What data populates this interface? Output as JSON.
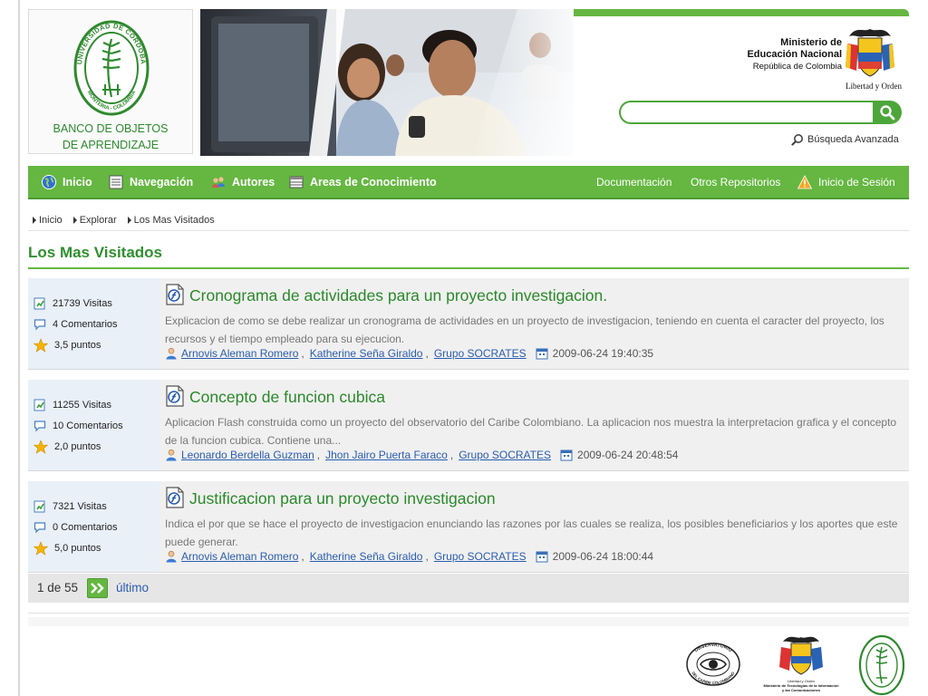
{
  "header": {
    "site_name_line1": "BANCO DE OBJETOS",
    "site_name_line2": "DE APRENDIZAJE",
    "seal_top_text": "UNIVERSIDAD DE CORDOBA",
    "seal_bottom_text": "MONTERIA - COLOMBIA",
    "ministry_line1": "Ministerio de",
    "ministry_line2": "Educación Nacional",
    "ministry_line3": "República de Colombia",
    "motto": "Libertad y Orden",
    "search_placeholder": "",
    "advanced_search": "Búsqueda Avanzada"
  },
  "nav": {
    "inicio": "Inicio",
    "navegacion": "Navegación",
    "autores": "Autores",
    "areas": "Areas de Conocimiento",
    "documentacion": "Documentación",
    "otros": "Otros Repositorios",
    "sesion": "Inicio de Sesión"
  },
  "breadcrumb": [
    "Inicio",
    "Explorar",
    "Los Mas Visitados"
  ],
  "section_title": "Los Mas Visitados",
  "items": [
    {
      "visits": "21739 Visitas",
      "comments": "4 Comentarios",
      "points": "3,5 puntos",
      "title": "Cronograma de actividades para un proyecto investigacion.",
      "description": "Explicacion de como se debe realizar un cronograma de actividades en un proyecto de investigacion, teniendo en cuenta el caracter del proyecto, los recursos y el tiempo empleado para su ejecucion.",
      "authors": [
        "Arnovis Aleman Romero",
        "Katherine Seña Giraldo",
        "Grupo SOCRATES"
      ],
      "date": "2009-06-24 19:40:35"
    },
    {
      "visits": "11255 Visitas",
      "comments": "10 Comentarios",
      "points": "2,0 puntos",
      "title": "Concepto de funcion cubica",
      "description": "Aplicacion Flash construida como un proyecto del observatorio del Caribe Colombiano. La aplicacion nos muestra la interpretacion grafica y el concepto de la funcion cubica. Contiene una...",
      "authors": [
        "Leonardo Berdella Guzman",
        "Jhon Jairo Puerta Faraco",
        "Grupo SOCRATES"
      ],
      "date": "2009-06-24 20:48:54"
    },
    {
      "visits": "7321 Visitas",
      "comments": "0 Comentarios",
      "points": "5,0 puntos",
      "title": "Justificacion para un proyecto investigacion",
      "description": "Indica el por que se hace el proyecto de investigacion enunciando las razones por las cuales se realiza, los posibles beneficiarios y los aportes que este puede generar.",
      "authors": [
        "Arnovis Aleman Romero",
        "Katherine Seña Giraldo",
        "Grupo SOCRATES"
      ],
      "date": "2009-06-24 18:00:44"
    }
  ],
  "pager": {
    "count": "1 de 55",
    "last": "último"
  },
  "footer": {
    "observatorio_top": "OBSERVATORIO",
    "observatorio_bottom": "DEL CARIBE COLOMBIANO",
    "mintic_line1": "Ministerio de Tecnologías de la Información",
    "mintic_line2": "y las Comunicaciones",
    "mintic_motto": "Libertad y Orden"
  },
  "colors": {
    "primary_green": "#65b741",
    "title_green": "#2f8f2f",
    "link_blue": "#2a5db0"
  }
}
